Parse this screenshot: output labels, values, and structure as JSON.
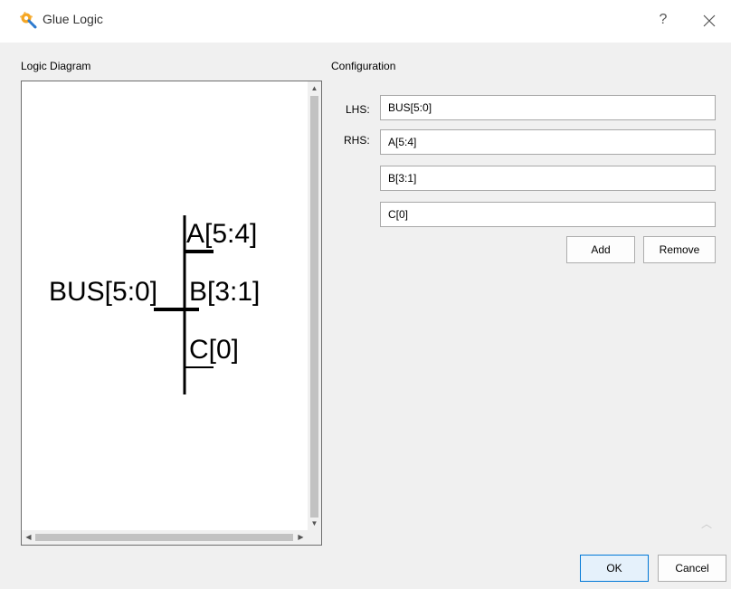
{
  "window": {
    "title": "Glue Logic",
    "app_icon": "wrench-gear-icon",
    "help_label": "?",
    "close_icon": "close-icon"
  },
  "diagram": {
    "section_label": "Logic Diagram",
    "lhs_label": "BUS[5:0]",
    "rhs_labels": [
      "A[5:4]",
      "B[3:1]",
      "C[0]"
    ]
  },
  "config": {
    "section_label": "Configuration",
    "lhs_label": "LHS:",
    "rhs_label": "RHS:",
    "lhs_value": "BUS[5:0]",
    "rhs_values": [
      "A[5:4]",
      "B[3:1]",
      "C[0]"
    ],
    "add_label": "Add",
    "remove_label": "Remove"
  },
  "footer": {
    "ok_label": "OK",
    "cancel_label": "Cancel"
  },
  "colors": {
    "titlebar_bg": "#ffffff",
    "dialog_bg": "#f0f0f0",
    "ok_border": "#0078d7"
  }
}
